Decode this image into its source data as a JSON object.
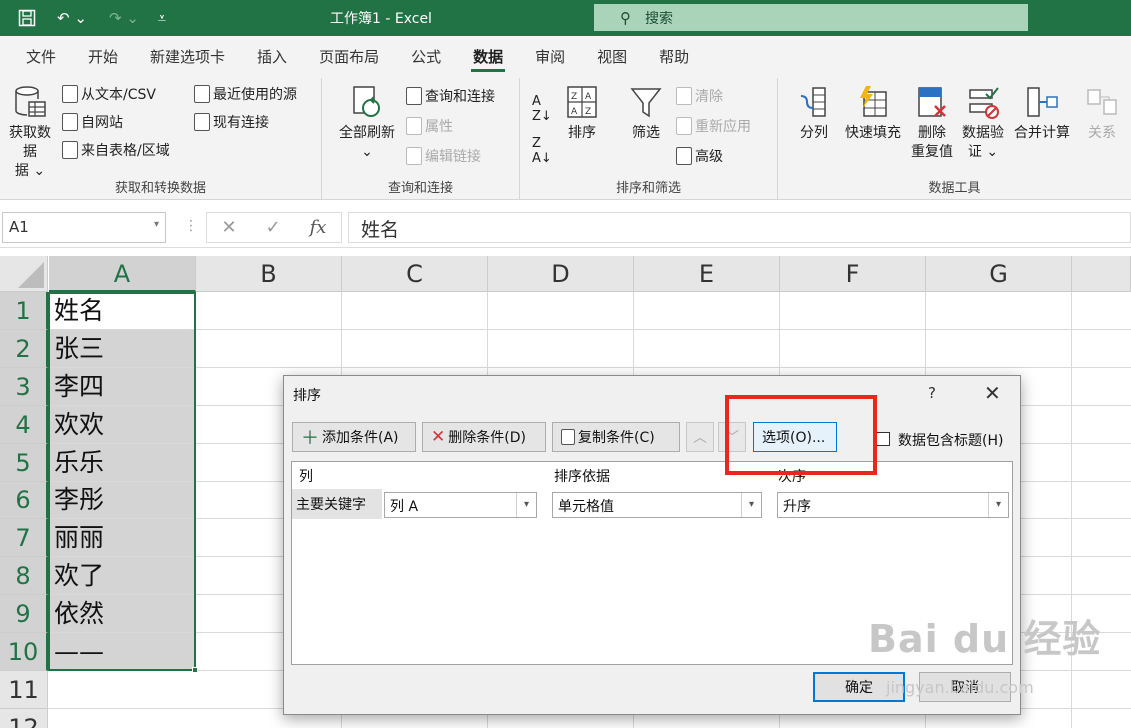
{
  "window": {
    "title": "工作簿1 - Excel",
    "search_placeholder": "搜索"
  },
  "tabs": [
    "文件",
    "开始",
    "新建选项卡",
    "插入",
    "页面布局",
    "公式",
    "数据",
    "审阅",
    "视图",
    "帮助"
  ],
  "active_tab": "数据",
  "ribbon": {
    "get_data": {
      "big": "获取数据",
      "big2": "据 ⌄",
      "small": [
        "从文本/CSV",
        "自网站",
        "来自表格/区域",
        "最近使用的源",
        "现有连接"
      ],
      "label": "获取和转换数据"
    },
    "queries": {
      "refresh": "全部刷新",
      "refresh_dd": "⌄",
      "small": [
        "查询和连接",
        "属性",
        "编辑链接"
      ],
      "label": "查询和连接"
    },
    "sort": {
      "sort": "排序",
      "filter": "筛选",
      "small": [
        "清除",
        "重新应用",
        "高级"
      ],
      "label": "排序和筛选"
    },
    "tools": {
      "buttons": [
        "分列",
        "快速填充",
        "删除",
        "数据验",
        "合并计算",
        "关系"
      ],
      "buttons2": [
        "重复值",
        "证 ⌄"
      ],
      "label": "数据工具"
    }
  },
  "formula": {
    "namebox": "A1",
    "content": "姓名",
    "fx": "fx"
  },
  "columns": [
    "A",
    "B",
    "C",
    "D",
    "E",
    "F",
    "G"
  ],
  "rows": [
    "1",
    "2",
    "3",
    "4",
    "5",
    "6",
    "7",
    "8",
    "9",
    "10",
    "11",
    "12"
  ],
  "cells_a": [
    "姓名",
    "张三",
    "李四",
    "欢欢",
    "乐乐",
    "李彤",
    "丽丽",
    "欢了",
    "依然",
    "——"
  ],
  "dialog": {
    "title": "排序",
    "help": "?",
    "close": "✕",
    "add": "添加条件(A)",
    "delete": "删除条件(D)",
    "copy": "复制条件(C)",
    "options": "选项(O)...",
    "has_header": "数据包含标题(H)",
    "col_header": "列",
    "basis_header": "排序依据",
    "order_header": "次序",
    "key_label": "主要关键字",
    "col_value": "列 A",
    "basis_value": "单元格值",
    "order_value": "升序",
    "ok": "确定",
    "cancel": "取消"
  },
  "watermark": {
    "text": "Bai du 经验",
    "sub": "jingyan.baidu.com"
  }
}
